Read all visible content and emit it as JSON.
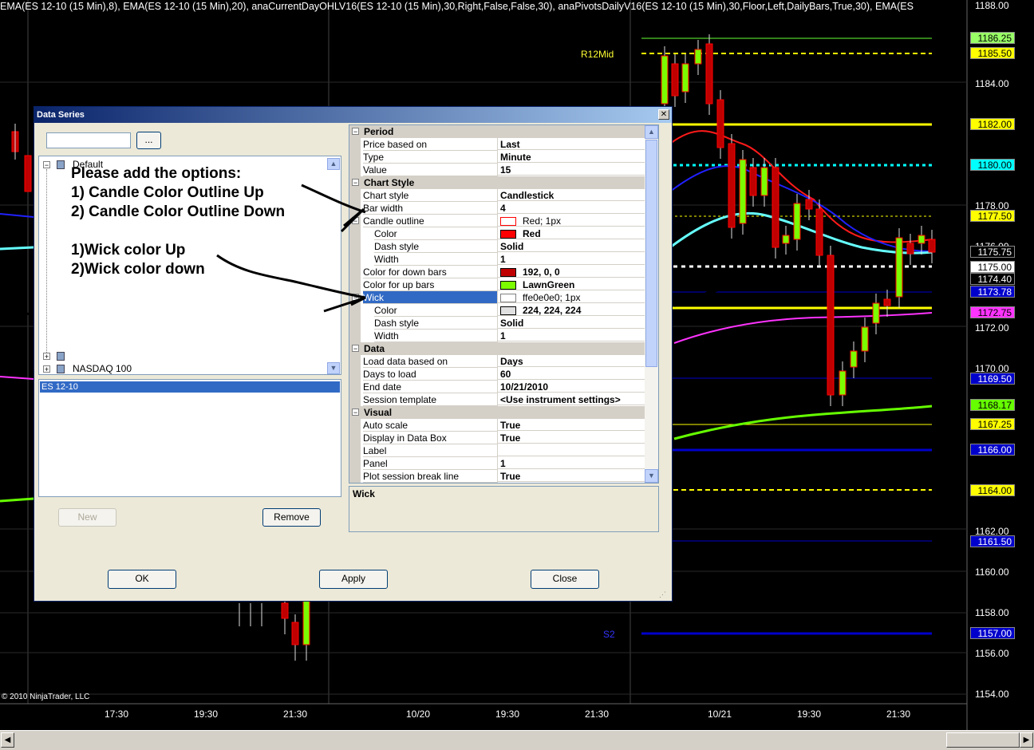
{
  "chart": {
    "indicator_line": "EMA(ES 12-10 (15 Min),8), EMA(ES 12-10 (15 Min),20), anaCurrentDayOHLV16(ES 12-10 (15 Min),30,Right,False,False,30), anaPivotsDailyV16(ES 12-10 (15 Min),30,Floor,Left,DailyBars,True,30), EMA(ES",
    "copyright": "© 2010 NinjaTrader, LLC",
    "level_labels": {
      "r12mid": "R12Mid",
      "s2": "S2"
    },
    "x_axis_labels": [
      "17:30",
      "19:30",
      "21:30",
      "10/20",
      "19:30",
      "21:30",
      "10/21",
      "19:30",
      "21:30"
    ],
    "y_axis_labels": [
      "1188.00",
      "1184.00",
      "1178.00",
      "1176.00",
      "1172.00",
      "1170.00",
      "1162.00",
      "1160.00",
      "1158.00",
      "1156.00",
      "1154.00"
    ],
    "price_tags": [
      {
        "value": "1186.25",
        "bg": "#99ff66",
        "fg": "#000000"
      },
      {
        "value": "1185.50",
        "bg": "#ffff00",
        "fg": "#000000"
      },
      {
        "value": "1182.00",
        "bg": "#ffff00",
        "fg": "#000000"
      },
      {
        "value": "1180.00",
        "bg": "#00ffff",
        "fg": "#000000"
      },
      {
        "value": "1177.50",
        "bg": "#ffff00",
        "fg": "#000000"
      },
      {
        "value": "1175.75",
        "bg": "#000000",
        "fg": "#ffffff"
      },
      {
        "value": "1175.00",
        "bg": "#ffffff",
        "fg": "#000000"
      },
      {
        "value": "1174.40",
        "bg": "#000000",
        "fg": "#ffffff"
      },
      {
        "value": "1173.78",
        "bg": "#0000cc",
        "fg": "#ffffff"
      },
      {
        "value": "1172.75",
        "bg": "#ff33ff",
        "fg": "#000000"
      },
      {
        "value": "1169.50",
        "bg": "#0000cc",
        "fg": "#ffffff"
      },
      {
        "value": "1168.17",
        "bg": "#66ff00",
        "fg": "#000000"
      },
      {
        "value": "1167.25",
        "bg": "#ffff00",
        "fg": "#000000"
      },
      {
        "value": "1166.00",
        "bg": "#0000cc",
        "fg": "#ffffff"
      },
      {
        "value": "1164.00",
        "bg": "#ffff00",
        "fg": "#000000"
      },
      {
        "value": "1161.50",
        "bg": "#0000cc",
        "fg": "#ffffff"
      },
      {
        "value": "1157.00",
        "bg": "#0000cc",
        "fg": "#ffffff"
      }
    ]
  },
  "dialog": {
    "title": "Data Series",
    "close_glyph": "✕",
    "browse_label": "...",
    "tree_items": [
      "Default",
      "",
      "NASDAQ 100"
    ],
    "instrument": "ES 12-10",
    "new_label": "New",
    "remove_label": "Remove",
    "ok_label": "OK",
    "apply_label": "Apply",
    "close_label": "Close",
    "help_text": "Wick",
    "properties": [
      {
        "kind": "cat",
        "name": "Period"
      },
      {
        "kind": "prop",
        "name": "Price based on",
        "value": "Last"
      },
      {
        "kind": "prop",
        "name": "Type",
        "value": "Minute"
      },
      {
        "kind": "prop",
        "name": "Value",
        "value": "15"
      },
      {
        "kind": "cat",
        "name": "Chart Style"
      },
      {
        "kind": "prop",
        "name": "Chart style",
        "value": "Candlestick"
      },
      {
        "kind": "prop",
        "name": "Bar width",
        "value": "4"
      },
      {
        "kind": "prop",
        "name": "Candle outline",
        "value": "Red; 1px",
        "expand": "⊟",
        "swatch": "#ffffff",
        "swatch_border": "#ff0000",
        "plain": true
      },
      {
        "kind": "prop",
        "name": "Color",
        "value": "Red",
        "indent": true,
        "swatch": "#ff0000"
      },
      {
        "kind": "prop",
        "name": "Dash style",
        "value": "Solid",
        "indent": true
      },
      {
        "kind": "prop",
        "name": "Width",
        "value": "1",
        "indent": true
      },
      {
        "kind": "prop",
        "name": "Color for down bars",
        "value": "192, 0, 0",
        "swatch": "#c00000"
      },
      {
        "kind": "prop",
        "name": "Color for up bars",
        "value": "LawnGreen",
        "swatch": "#7cfc00"
      },
      {
        "kind": "prop",
        "name": "Wick",
        "value": "ffe0e0e0; 1px",
        "expand": "⊟",
        "swatch": "#ffffff",
        "swatch_border": "#808080",
        "selected": true,
        "plain": true
      },
      {
        "kind": "prop",
        "name": "Color",
        "value": "224, 224, 224",
        "indent": true,
        "swatch": "#e0e0e0"
      },
      {
        "kind": "prop",
        "name": "Dash style",
        "value": "Solid",
        "indent": true
      },
      {
        "kind": "prop",
        "name": "Width",
        "value": "1",
        "indent": true
      },
      {
        "kind": "cat",
        "name": "Data"
      },
      {
        "kind": "prop",
        "name": "Load data based on",
        "value": "Days"
      },
      {
        "kind": "prop",
        "name": "Days to load",
        "value": "60"
      },
      {
        "kind": "prop",
        "name": "End date",
        "value": "10/21/2010"
      },
      {
        "kind": "prop",
        "name": "Session template",
        "value": "<Use instrument settings>"
      },
      {
        "kind": "cat",
        "name": "Visual"
      },
      {
        "kind": "prop",
        "name": "Auto scale",
        "value": "True"
      },
      {
        "kind": "prop",
        "name": "Display in Data Box",
        "value": "True"
      },
      {
        "kind": "prop",
        "name": "Label",
        "value": ""
      },
      {
        "kind": "prop",
        "name": "Panel",
        "value": "1"
      },
      {
        "kind": "prop",
        "name": "Plot session break line",
        "value": "True"
      }
    ]
  },
  "annotation": {
    "lines": [
      "Please add the options:",
      "1) Candle Color Outline Up",
      "2) Candle Color Outline Down",
      "1)Wick color Up",
      "2)Wick color down"
    ]
  }
}
